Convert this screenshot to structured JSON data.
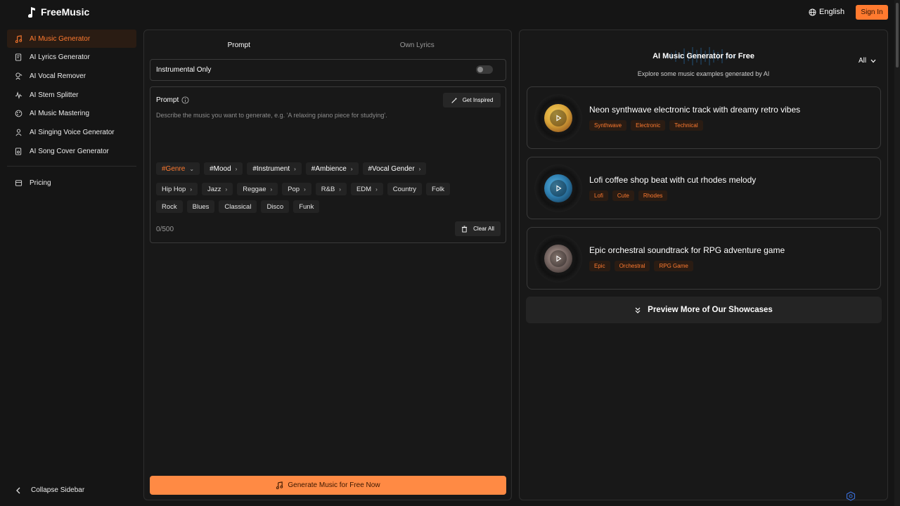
{
  "brand": {
    "name": "FreeMusic"
  },
  "header": {
    "language": "English",
    "signin": "Sign In"
  },
  "sidebar": {
    "items": [
      {
        "label": "AI Music Generator",
        "icon": "music-note-icon",
        "active": true
      },
      {
        "label": "AI Lyrics Generator",
        "icon": "lyrics-icon"
      },
      {
        "label": "AI Vocal Remover",
        "icon": "vocal-icon"
      },
      {
        "label": "AI Stem Splitter",
        "icon": "stem-icon"
      },
      {
        "label": "AI Music Mastering",
        "icon": "mastering-icon"
      },
      {
        "label": "AI Singing Voice Generator",
        "icon": "singer-icon"
      },
      {
        "label": "AI Song Cover Generator",
        "icon": "cover-icon"
      }
    ],
    "pricing": "Pricing",
    "collapse": "Collapse Sidebar"
  },
  "tabs": [
    {
      "label": "Prompt"
    },
    {
      "label": "Own Lyrics"
    }
  ],
  "instrumental": {
    "label": "Instrumental Only",
    "on": false
  },
  "prompt": {
    "label": "Prompt",
    "inspire": "Get Inspired",
    "placeholder": "Describe the music you want to generate, e.g. 'A relaxing piano piece for studying'.",
    "value": "",
    "counter": "0/500",
    "clear": "Clear All",
    "categories": [
      "#Genre",
      "#Mood",
      "#Instrument",
      "#Ambience",
      "#Vocal Gender"
    ],
    "genres_row1": [
      "Hip Hop",
      "Jazz",
      "Reggae",
      "Pop",
      "R&B",
      "EDM",
      "Country",
      "Folk"
    ],
    "genres_row2": [
      "Rock",
      "Blues",
      "Classical",
      "Disco",
      "Funk"
    ],
    "genres_with_arrow": [
      "Hip Hop",
      "Jazz",
      "Reggae",
      "Pop",
      "R&B",
      "EDM"
    ]
  },
  "generate": "Generate Music for Free Now",
  "showcase": {
    "title": "AI Music Generator for Free",
    "subtitle": "Explore some music examples generated by AI",
    "filter": "All",
    "cards": [
      {
        "title": "Neon synthwave electronic track with dreamy retro vibes",
        "tags": [
          "Synthwave",
          "Electronic",
          "Technical"
        ],
        "art": "#d8a43a"
      },
      {
        "title": "Lofi coffee shop beat with cut rhodes melody",
        "tags": [
          "Lofi",
          "Cute",
          "Rhodes"
        ],
        "art": "#2f7fb0"
      },
      {
        "title": "Epic orchestral soundtrack for RPG adventure game",
        "tags": [
          "Epic",
          "Orchestral",
          "RPG Game"
        ],
        "art": "#7a6a66"
      }
    ],
    "more": "Preview More of Our Showcases"
  },
  "accent": "#ff7a2f"
}
